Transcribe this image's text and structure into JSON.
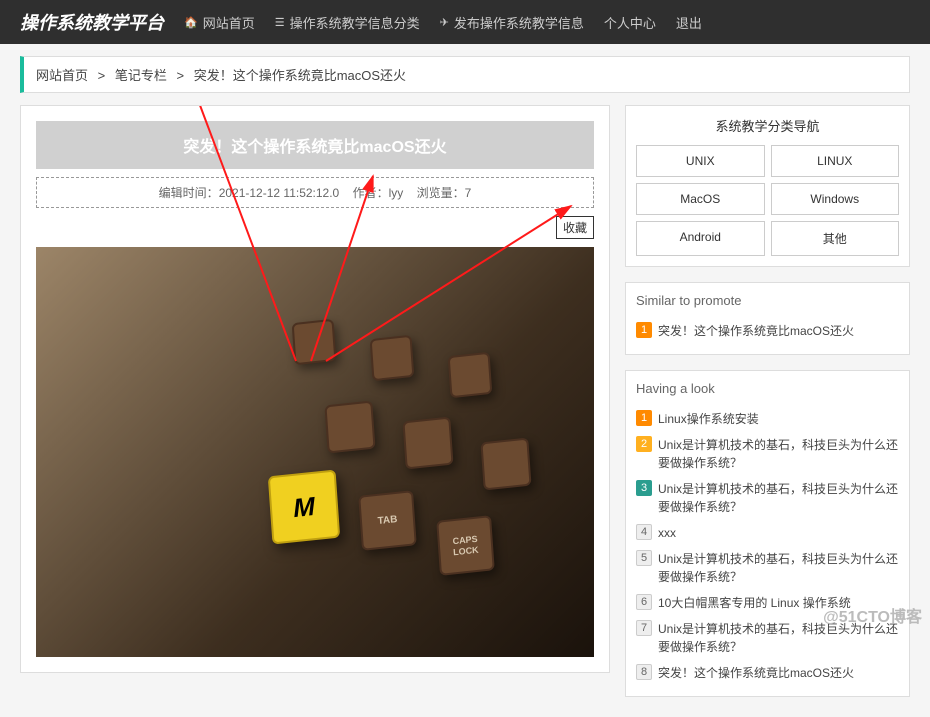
{
  "nav": {
    "brand": "操作系统教学平台",
    "items": [
      {
        "icon": "home",
        "label": "网站首页"
      },
      {
        "icon": "list",
        "label": "操作系统教学信息分类"
      },
      {
        "icon": "send",
        "label": "发布操作系统教学信息"
      },
      {
        "icon": "",
        "label": "个人中心"
      },
      {
        "icon": "",
        "label": "退出"
      }
    ]
  },
  "breadcrumb": {
    "items": [
      "网站首页",
      "笔记专栏",
      "突发！这个操作系统竟比macOS还火"
    ]
  },
  "article": {
    "title": "突发！这个操作系统竟比macOS还火",
    "edit_time_label": "编辑时间：",
    "edit_time": "2021-12-12 11:52:12.0",
    "author_label": "作者：",
    "author": "lyy",
    "views_label": "浏览量：",
    "views": "7",
    "favorite_label": "收藏"
  },
  "side": {
    "cat_title": "系统教学分类导航",
    "cats": [
      "UNIX",
      "LINUX",
      "MacOS",
      "Windows",
      "Android",
      "其他"
    ],
    "promote_title": "Similar to promote",
    "promote_items": [
      "突发！这个操作系统竟比macOS还火"
    ],
    "look_title": "Having a look",
    "look_items": [
      "Linux操作系统安装",
      "Unix是计算机技术的基石，科技巨头为什么还要做操作系统？",
      "Unix是计算机技术的基石，科技巨头为什么还要做操作系统？",
      "xxx",
      "Unix是计算机技术的基石，科技巨头为什么还要做操作系统？",
      "10大白帽黑客专用的 Linux 操作系统",
      "Unix是计算机技术的基石，科技巨头为什么还要做操作系统？",
      "突发！这个操作系统竟比macOS还火"
    ]
  },
  "watermark": "@51CTO博客"
}
